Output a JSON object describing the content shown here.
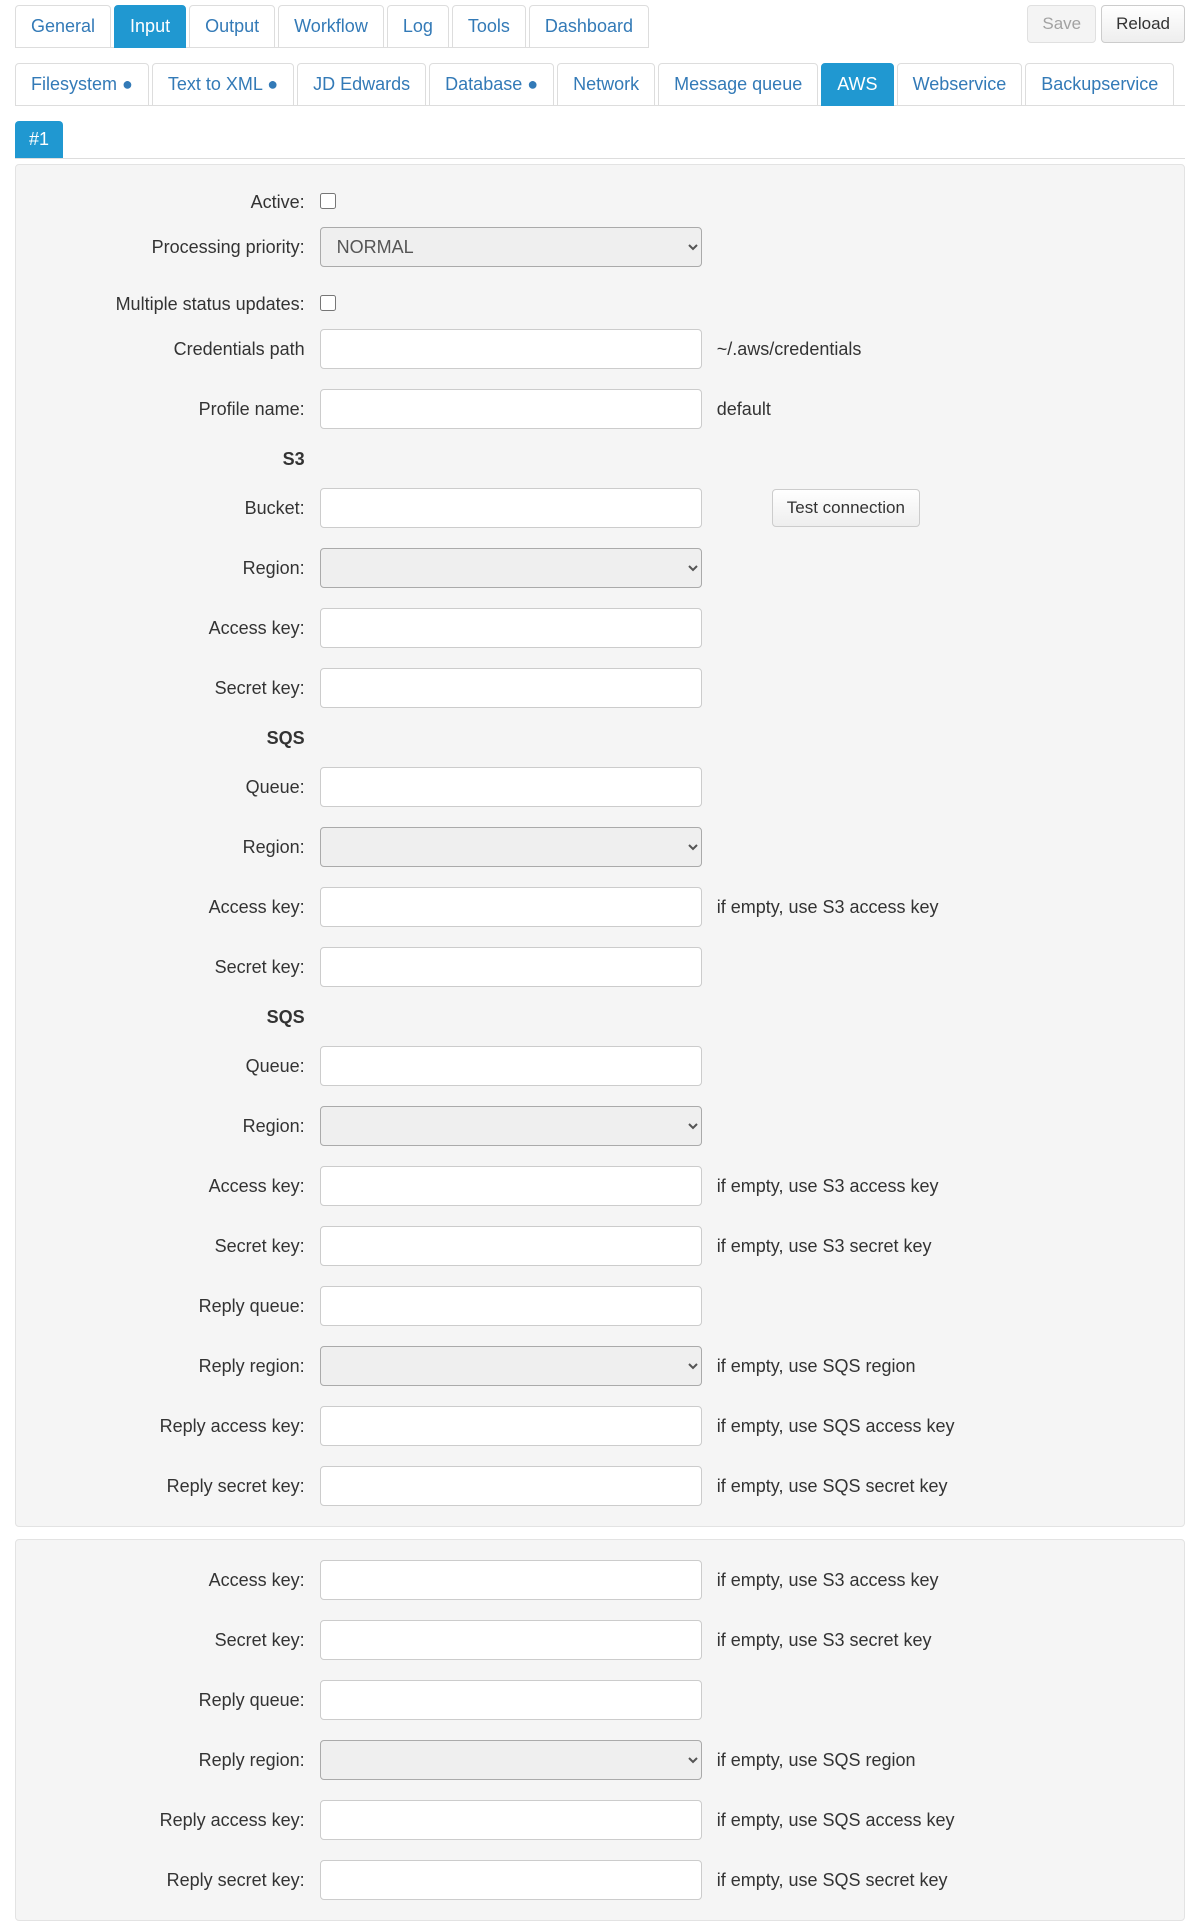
{
  "buttons": {
    "save": "Save",
    "reload": "Reload",
    "test_connection": "Test connection"
  },
  "main_tabs": [
    {
      "label": "General"
    },
    {
      "label": "Input",
      "active": true
    },
    {
      "label": "Output"
    },
    {
      "label": "Workflow"
    },
    {
      "label": "Log"
    },
    {
      "label": "Tools"
    },
    {
      "label": "Dashboard"
    }
  ],
  "sub_tabs": [
    {
      "label": "Filesystem ●"
    },
    {
      "label": "Text to XML ●"
    },
    {
      "label": "JD Edwards"
    },
    {
      "label": "Database ●"
    },
    {
      "label": "Network"
    },
    {
      "label": "Message queue"
    },
    {
      "label": "AWS",
      "active": true
    },
    {
      "label": "Webservice"
    },
    {
      "label": "Backupservice"
    }
  ],
  "instance_tabs": [
    {
      "label": "#1",
      "active": true
    }
  ],
  "panel1": {
    "active_label": "Active:",
    "priority_label": "Processing priority:",
    "priority_value": "NORMAL",
    "multi_status_label": "Multiple status updates:",
    "credentials_label": "Credentials path",
    "credentials_hint": "~/.aws/credentials",
    "profile_label": "Profile name:",
    "profile_hint": "default",
    "s3_section": "S3",
    "bucket_label": "Bucket:",
    "region_label": "Region:",
    "access_key_label": "Access key:",
    "secret_key_label": "Secret key:",
    "sqs1_section": "SQS",
    "sqs1_queue_label": "Queue:",
    "sqs1_region_label": "Region:",
    "sqs1_access_key_label": "Access key:",
    "sqs1_access_key_hint": "if empty, use S3 access key",
    "sqs1_secret_key_label": "Secret key:",
    "sqs2_section": "SQS",
    "sqs2_queue_label": "Queue:",
    "sqs2_region_label": "Region:",
    "sqs2_access_key_label": "Access key:",
    "sqs2_access_key_hint": "if empty, use S3 access key",
    "sqs2_secret_key_label": "Secret key:",
    "sqs2_secret_key_hint": "if empty, use S3 secret key",
    "sqs2_reply_queue_label": "Reply queue:",
    "sqs2_reply_region_label": "Reply region:",
    "sqs2_reply_region_hint": "if empty, use SQS region",
    "sqs2_reply_access_key_label": "Reply access key:",
    "sqs2_reply_access_key_hint": "if empty, use SQS access key",
    "sqs2_reply_secret_key_label": "Reply secret key:",
    "sqs2_reply_secret_key_hint": "if empty, use SQS secret key"
  },
  "panel2": {
    "access_key_label": "Access key:",
    "access_key_hint": "if empty, use S3 access key",
    "secret_key_label": "Secret key:",
    "secret_key_hint": "if empty, use S3 secret key",
    "reply_queue_label": "Reply queue:",
    "reply_region_label": "Reply region:",
    "reply_region_hint": "if empty, use SQS region",
    "reply_access_key_label": "Reply access key:",
    "reply_access_key_hint": "if empty, use SQS access key",
    "reply_secret_key_label": "Reply secret key:",
    "reply_secret_key_hint": "if empty, use SQS secret key"
  }
}
